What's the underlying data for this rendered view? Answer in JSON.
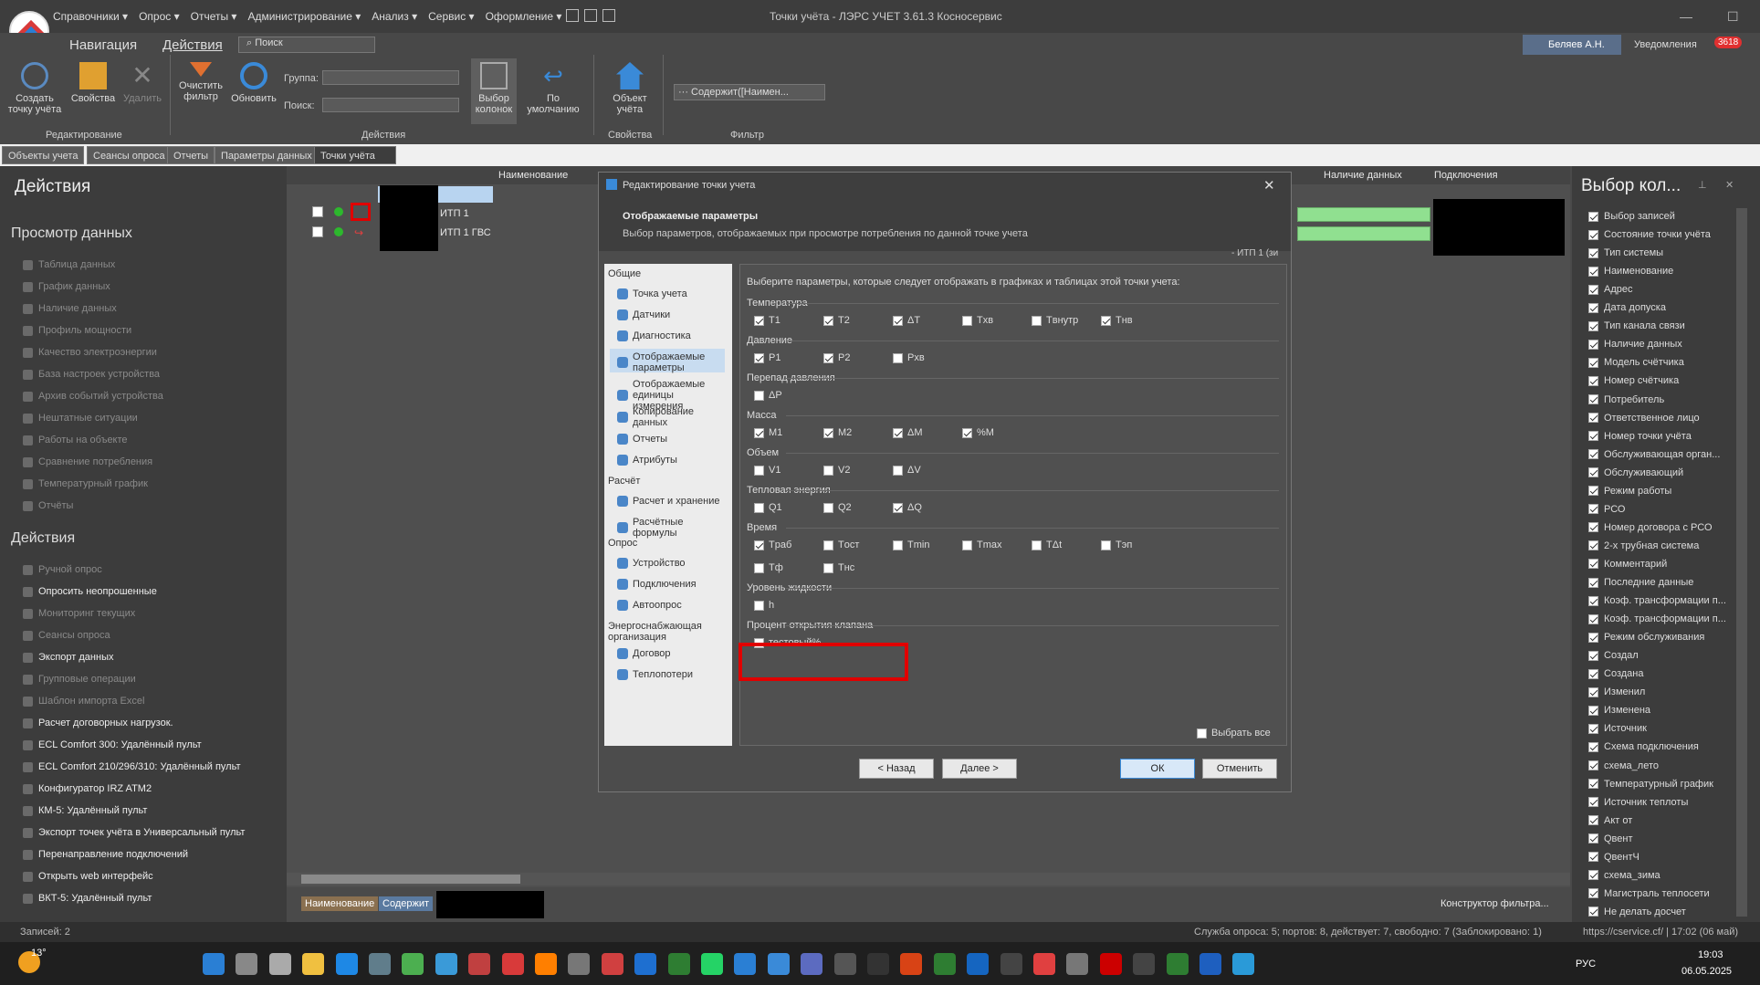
{
  "app": {
    "title": "Точки учёта - ЛЭРС УЧЕТ 3.61.3 Косносервис",
    "menu": [
      "Справочники ▾",
      "Опрос ▾",
      "Отчеты ▾",
      "Администрирование ▾",
      "Анализ ▾",
      "Сервис ▾",
      "Оформление ▾"
    ]
  },
  "ribbon": {
    "tabs": [
      "Навигация",
      "Действия"
    ],
    "search_placeholder": "Поиск",
    "user": "Беляев А.Н.",
    "notifications": "Уведомления",
    "notif_count": "3618",
    "buttons": [
      "Создать точку учёта",
      "Свойства",
      "Удалить",
      "Очистить фильтр",
      "Обновить",
      "Выбор колонок",
      "По умолчанию",
      "Объект учёта"
    ],
    "group_label": "Группа:",
    "find_label": "Поиск:",
    "filter_value": "··· Содержит([Наимен...",
    "groups": [
      "Редактирование",
      "Действия",
      "Свойства",
      "Фильтр"
    ]
  },
  "doc_tabs": [
    "Объекты учета",
    "Сеансы опроса",
    "Отчеты",
    "Параметры данных",
    "Точки учёта"
  ],
  "left": {
    "title": "Действия",
    "sec1": "Просмотр данных",
    "view_items": [
      "Таблица данных",
      "График данных",
      "Наличие данных",
      "Профиль мощности",
      "Качество электроэнергии",
      "База настроек устройства",
      "Архив событий устройства",
      "Нештатные ситуации",
      "Работы на объекте",
      "Сравнение потребления",
      "Температурный график",
      "Отчёты"
    ],
    "sec2": "Действия",
    "action_items": [
      "Ручной опрос",
      "Опросить неопрошенные",
      "Мониторинг текущих",
      "Сеансы опроса",
      "Экспорт данных",
      "Групповые операции",
      "Шаблон импорта Excel",
      "Расчет договорных нагрузок.",
      "ECL Comfort 300: Удалённый пульт",
      "ECL Comfort 210/296/310: Удалённый пульт",
      "Конфигуратор IRZ ATM2",
      "КМ-5: Удалённый пульт",
      "Экспорт точек учёта в Универсальный пульт",
      "Перенаправление подключений",
      "Открыть web интерфейс",
      "ВКТ-5: Удалённый пульт"
    ]
  },
  "grid": {
    "columns": [
      "Наименование",
      "Наличие данных",
      "Подключения"
    ],
    "rows": [
      "ИТП 1",
      "ИТП 1 ГВС"
    ],
    "filter_tags": [
      "Наименование",
      "Содержит"
    ],
    "constructor": "Конструктор фильтра..."
  },
  "right": {
    "title": "Выбор кол...",
    "items": [
      "Выбор записей",
      "Состояние точки учёта",
      "Тип системы",
      "Наименование",
      "Адрес",
      "Дата допуска",
      "Тип канала связи",
      "Наличие данных",
      "Модель счётчика",
      "Номер счётчика",
      "Потребитель",
      "Ответственное лицо",
      "Номер точки учёта",
      "Обслуживающая орган...",
      "Обслуживающий",
      "Режим работы",
      "РСО",
      "Номер договора с РСО",
      "2-х трубная система",
      "Комментарий",
      "Последние данные",
      "Коэф. трансформации п...",
      "Коэф. трансформации п...",
      "Режим обслуживания",
      "Создал",
      "Создана",
      "Изменил",
      "Изменена",
      "Источник",
      "Схема подключения",
      "схема_лето",
      "Температурный график",
      "Источник теплоты",
      "Акт от",
      "Qвент",
      "QвентЧ",
      "схема_зима",
      "Магистраль теплосети",
      "Не делать досчет"
    ]
  },
  "dialog": {
    "title": "Редактирование точки учета",
    "header": "Отображаемые параметры",
    "subheader": "Выбор параметров, отображаемых при просмотре потребления по данной точке учета",
    "crumb": "- ИТП 1 (зи",
    "intro": "Выберите параметры, которые следует отображать в графиках и таблицах этой точки учета:",
    "nav": [
      {
        "t": "s",
        "l": "Общие"
      },
      {
        "t": "i",
        "l": "Точка учета"
      },
      {
        "t": "i",
        "l": "Датчики"
      },
      {
        "t": "i",
        "l": "Диагностика"
      },
      {
        "t": "i",
        "l": "Отображаемые параметры"
      },
      {
        "t": "i",
        "l": "Отображаемые единицы измерения"
      },
      {
        "t": "i",
        "l": "Копирование данных"
      },
      {
        "t": "i",
        "l": "Отчеты"
      },
      {
        "t": "i",
        "l": "Атрибуты"
      },
      {
        "t": "s",
        "l": "Расчёт"
      },
      {
        "t": "i",
        "l": "Расчет и хранение"
      },
      {
        "t": "i",
        "l": "Расчётные формулы"
      },
      {
        "t": "s",
        "l": "Опрос"
      },
      {
        "t": "i",
        "l": "Устройство"
      },
      {
        "t": "i",
        "l": "Подключения"
      },
      {
        "t": "i",
        "l": "Автоопрос"
      },
      {
        "t": "s",
        "l": "Энергоснабжающая организация"
      },
      {
        "t": "i",
        "l": "Договор"
      },
      {
        "t": "i",
        "l": "Теплопотери"
      }
    ],
    "groups": [
      {
        "name": "Температура",
        "opts": [
          [
            "T1",
            true
          ],
          [
            "T2",
            true
          ],
          [
            "ΔT",
            true
          ],
          [
            "Tхв",
            false
          ],
          [
            "Tвнутр",
            false
          ],
          [
            "Tнв",
            true
          ]
        ]
      },
      {
        "name": "Давление",
        "opts": [
          [
            "P1",
            true
          ],
          [
            "P2",
            true
          ],
          [
            "Pхв",
            false
          ]
        ]
      },
      {
        "name": "Перепад давления",
        "opts": [
          [
            "ΔP",
            false
          ]
        ]
      },
      {
        "name": "Масса",
        "opts": [
          [
            "M1",
            true
          ],
          [
            "M2",
            true
          ],
          [
            "ΔM",
            true
          ],
          [
            "%M",
            true
          ]
        ]
      },
      {
        "name": "Объем",
        "opts": [
          [
            "V1",
            false
          ],
          [
            "V2",
            false
          ],
          [
            "ΔV",
            false
          ]
        ]
      },
      {
        "name": "Тепловая энергия",
        "opts": [
          [
            "Q1",
            false
          ],
          [
            "Q2",
            false
          ],
          [
            "ΔQ",
            true
          ]
        ]
      },
      {
        "name": "Время",
        "opts": [
          [
            "Tраб",
            true
          ],
          [
            "Tост",
            false
          ],
          [
            "Tmin",
            false
          ],
          [
            "Tmax",
            false
          ],
          [
            "TΔt",
            false
          ],
          [
            "Tэп",
            false
          ],
          [
            "Tф",
            false
          ],
          [
            "Tнс",
            false
          ]
        ]
      },
      {
        "name": "Уровень жидкости",
        "opts": [
          [
            "h",
            false
          ]
        ]
      },
      {
        "name": "Процент открытия клапана",
        "opts": [
          [
            "тестовый%",
            false
          ]
        ]
      }
    ],
    "select_all": "Выбрать все",
    "back": "< Назад",
    "next": "Далее >",
    "ok": "ОК",
    "cancel": "Отменить"
  },
  "status": {
    "records": "Записей: 2",
    "service": "Служба опроса: 5; портов: 8, действует: 7, свободно: 7 (Заблокировано: 1)",
    "url": "https://cservice.cf/ | 17:02 (06 май)"
  },
  "taskbar": {
    "temp": "13°",
    "lang": "РУС",
    "time": "19:03",
    "date": "06.05.2025"
  },
  "colors": {
    "highlight": "#e00000",
    "green": "#90e090"
  }
}
